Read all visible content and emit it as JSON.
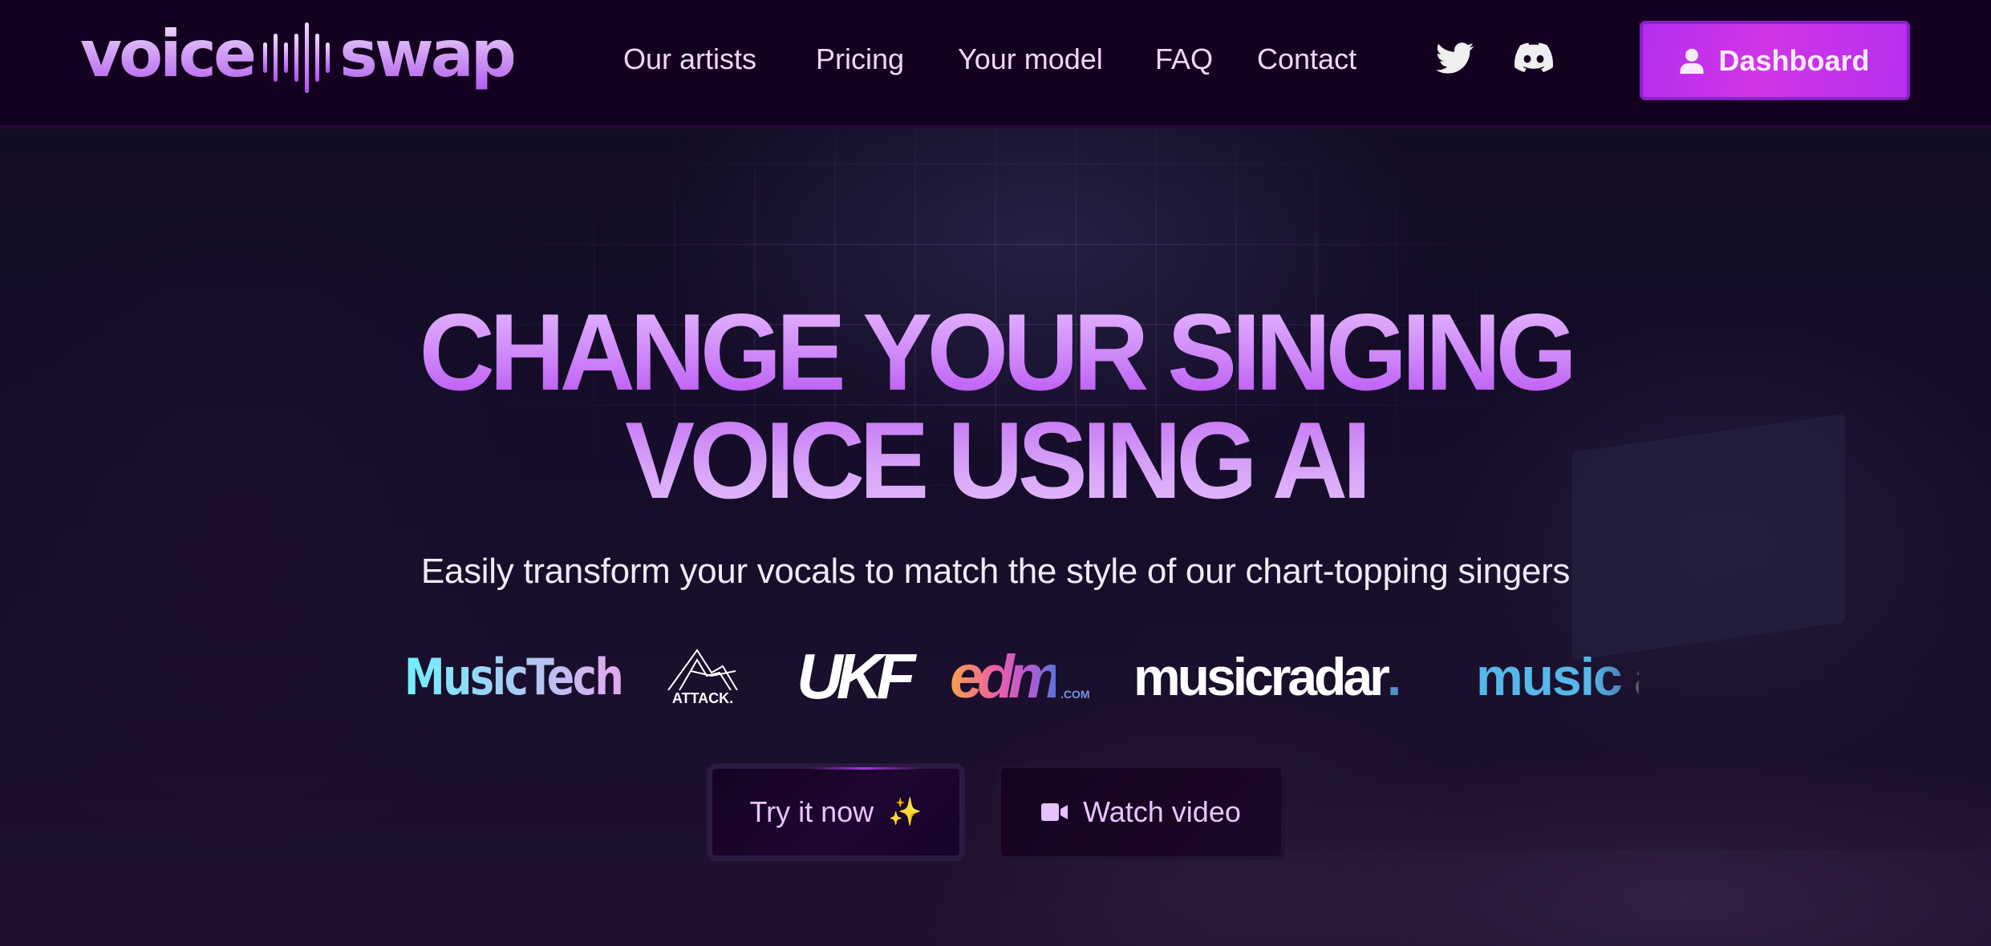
{
  "brand": {
    "name_left": "voice",
    "name_right": "swap",
    "wave_icon": "soundwave-icon"
  },
  "nav": {
    "items": [
      {
        "label": "Our artists"
      },
      {
        "label": "Pricing"
      },
      {
        "label": "Your model"
      },
      {
        "label": "FAQ"
      },
      {
        "label": "Contact"
      }
    ],
    "social": [
      {
        "icon": "twitter-icon"
      },
      {
        "icon": "discord-icon"
      }
    ],
    "dashboard": {
      "label": "Dashboard",
      "icon": "user-icon"
    }
  },
  "hero": {
    "headline_line1": "CHANGE YOUR SINGING",
    "headline_line2": "VOICE USING AI",
    "subtitle": "Easily transform your vocals to match the style of our chart-topping singers",
    "press_logos": [
      {
        "name": "MusicTech",
        "text": "MusicTech"
      },
      {
        "name": "Attack",
        "text": "ATTACK."
      },
      {
        "name": "UKF",
        "text": "UKF"
      },
      {
        "name": "edm.com",
        "text": "edm",
        "suffix": ".COM"
      },
      {
        "name": "musicradar",
        "text": "musicradar",
        "suffix": "."
      },
      {
        "name": "music (truncated)",
        "text": "music a"
      }
    ],
    "cta_primary": {
      "label": "Try it now",
      "icon": "sparkles-icon",
      "emoji": "✨"
    },
    "cta_secondary": {
      "label": "Watch video",
      "icon": "video-camera-icon"
    }
  },
  "colors": {
    "header_bg": "#14001f",
    "accent": "#c02fec",
    "nav_text": "#f0d6ff",
    "headline_light": "#e6b9ff",
    "headline_dark": "#b953f3",
    "cta_text": "#eac4ff"
  }
}
